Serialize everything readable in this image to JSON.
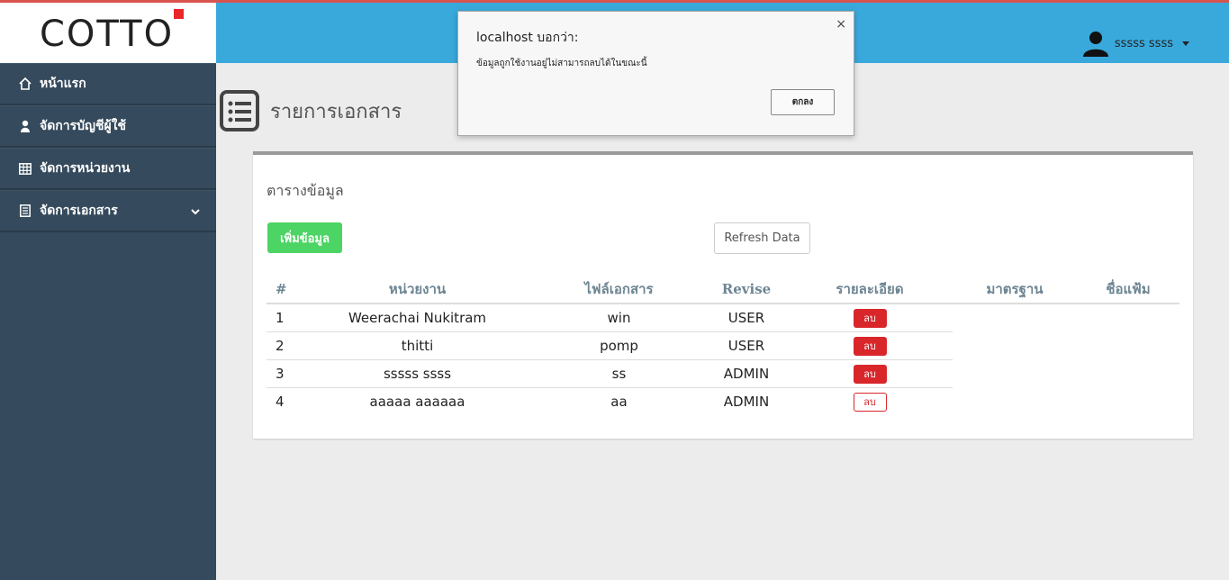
{
  "header": {
    "logo_text": "COTTO",
    "user_name": "sssss ssss"
  },
  "sidebar": {
    "items": [
      {
        "label": "หน้าแรก"
      },
      {
        "label": "จัดการบัญชีผู้ใช้"
      },
      {
        "label": "จัดการหน่วยงาน"
      },
      {
        "label": "จัดการเอกสาร"
      }
    ]
  },
  "main": {
    "page_title": "รายการเอกสาร",
    "card_title": "ตารางข้อมูล",
    "add_button": "เพิ่มข้อมูล",
    "refresh_button": "Refresh Data",
    "table": {
      "headers": [
        "#",
        "หน่วยงาน",
        "ไฟล์เอกสาร",
        "Revise",
        "รายละเอียด",
        "มาตรฐาน",
        "ชื่อแฟ้ม"
      ],
      "rows": [
        {
          "num": "1",
          "dept": "Weerachai Nukitram",
          "file": "win",
          "revise": "USER",
          "action": "ลบ"
        },
        {
          "num": "2",
          "dept": "thitti",
          "file": "pomp",
          "revise": "USER",
          "action": "ลบ"
        },
        {
          "num": "3",
          "dept": "sssss ssss",
          "file": "ss",
          "revise": "ADMIN",
          "action": "ลบ"
        },
        {
          "num": "4",
          "dept": "aaaaa aaaaaa",
          "file": "aa",
          "revise": "ADMIN",
          "action": "ลบ"
        }
      ]
    }
  },
  "dialog": {
    "title": "localhost บอกว่า:",
    "message": "ข้อมูลถูกใช้งานอยู่ไม่สามารถลบได้ในขณะนี้",
    "ok_label": "ตกลง",
    "close_glyph": "×"
  },
  "colors": {
    "header": "#39a9dc",
    "sidebar": "#354a5c",
    "add_button": "#4cd464",
    "delete_button": "#d9262a",
    "logo_accent": "#e8262a"
  }
}
